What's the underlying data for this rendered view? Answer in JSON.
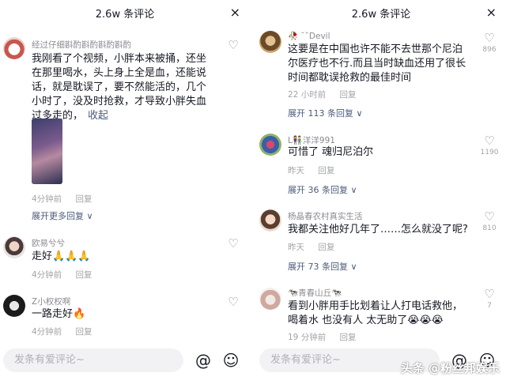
{
  "left": {
    "header": {
      "title": "2.6w 条评论",
      "close": "×"
    },
    "comments": [
      {
        "user": "经过仔细斟酌斟酌斟酌斟酌",
        "text": "我刚看了个视频，小胖本来被捅，还坐在那里喝水，头上身上全是血，还能说话，就是耽误了，要不然能活的，几个小时了，没及时抢救，才导致小胖失血过多走的，",
        "collapse": "收起",
        "time": "4分钟前",
        "reply": "回复",
        "expand": "展开更多回复 ∨"
      },
      {
        "user": "欧易兮兮",
        "text": "走好🙏🙏🙏",
        "time": "4分钟前",
        "reply": "回复"
      },
      {
        "user": "Z小权权啊",
        "text": "一路走好🔥",
        "time": "4分钟前",
        "reply": "回复"
      }
    ],
    "input_placeholder": "发条有爱评论~"
  },
  "right": {
    "header": {
      "title": "2.6w 条评论",
      "close": "×"
    },
    "comments": [
      {
        "user": "🥀 ˘ˇDevil",
        "text": "这要是在中国也许不能不去世那个尼泊尔医疗也不行.而且当时缺血还用了很长时间都耽误抢救的最佳时间",
        "time": "22 小时前",
        "reply": "回复",
        "likes": "896",
        "expand": "展开 113 条回复 ∨"
      },
      {
        "user": "L👫洋洋991",
        "text": "可惜了 魂归尼泊尔",
        "time": "昨天",
        "reply": "回复",
        "likes": "1190",
        "expand": "展开 36 条回复 ∨"
      },
      {
        "user": "杨晶春农村真实生活",
        "text": "我都关注他好几年了……怎么就没了呢?",
        "time": "昨天",
        "reply": "回复",
        "likes": "810",
        "expand": "展开 73 条回复 ∨"
      },
      {
        "user": "🐄青春山丘🐄",
        "text": "看到小胖用手比划着让人打电话救他，喝着水 也没有人 太无助了😭😭😭",
        "time": "19 分钟前",
        "reply": "回复",
        "likes": "7"
      }
    ],
    "input_placeholder": "发条有爱评论~"
  },
  "watermark": "头条 @粉丝邦娱乐",
  "icons": {
    "like": "heart-outline-icon",
    "at": "at-icon",
    "emoji": "emoji-icon",
    "close": "close-icon"
  }
}
